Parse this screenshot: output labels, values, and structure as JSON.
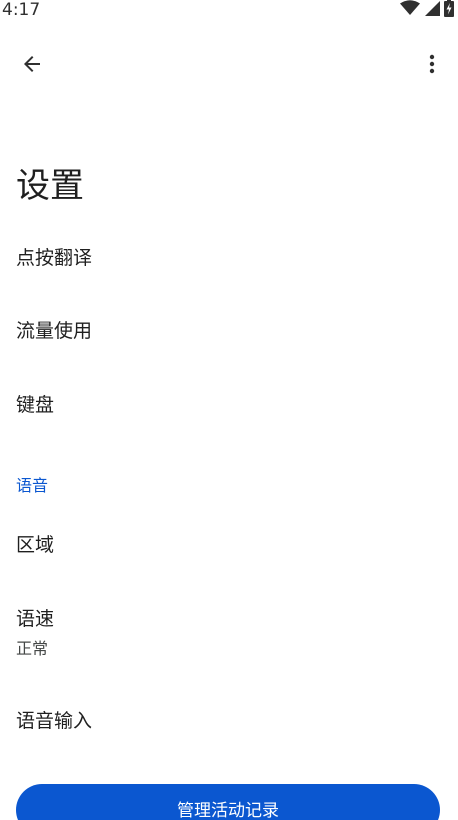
{
  "status_bar": {
    "time": "4:17",
    "icons": [
      "wifi-icon",
      "cellular-signal-icon",
      "battery-charging-icon"
    ]
  },
  "app_bar": {
    "back_icon": "arrow-back-icon",
    "more_icon": "more-vert-icon"
  },
  "page": {
    "title": "设置"
  },
  "items": {
    "tap_to_translate": {
      "title": "点按翻译"
    },
    "data_usage": {
      "title": "流量使用"
    },
    "keyboard": {
      "title": "键盘"
    }
  },
  "speech_section": {
    "header": "语音",
    "region": {
      "title": "区域"
    },
    "speech_rate": {
      "title": "语速",
      "summary": "正常"
    },
    "voice_input": {
      "title": "语音输入"
    }
  },
  "footer": {
    "manage_activity_label": "管理活动记录"
  },
  "colors": {
    "accent": "#0b57d0",
    "text_primary": "#1f1f1f",
    "text_secondary": "#444746",
    "background": "#ffffff"
  }
}
